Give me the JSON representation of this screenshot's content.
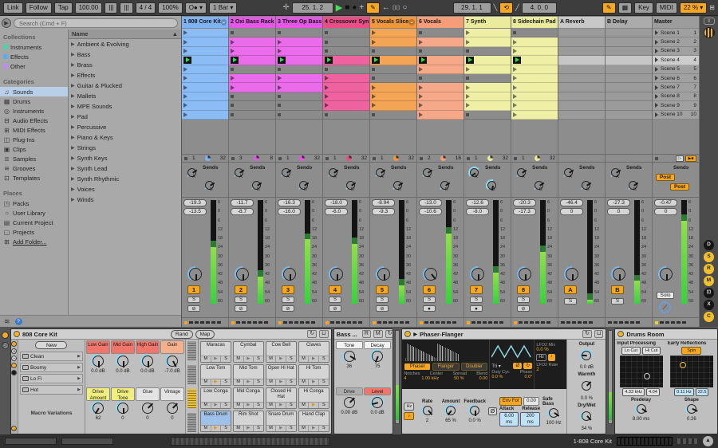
{
  "toolbar": {
    "link": "Link",
    "follow": "Follow",
    "tap": "Tap",
    "tempo": "100.00",
    "pips1": "|||",
    "pips2": "|||",
    "sig": "4 / 4",
    "quant": "100%",
    "groove": "O●",
    "bar": "1 Bar",
    "pos": "25. 1. 2",
    "loop_start": "29. 1. 1",
    "loop_len": "4. 0. 0",
    "key": "Key",
    "midi": "MIDI",
    "cpu": "22 %"
  },
  "browser": {
    "search_placeholder": "Search (Cmd + F)",
    "collections_label": "Collections",
    "collections": [
      {
        "label": "Instruments",
        "color": "#4ad6a5"
      },
      {
        "label": "Effects",
        "color": "#5aaef0"
      },
      {
        "label": "Other",
        "color": "#b98ef0"
      }
    ],
    "categories_label": "Categories",
    "categories": [
      {
        "icon": "♫",
        "label": "Sounds"
      },
      {
        "icon": "▦",
        "label": "Drums"
      },
      {
        "icon": "◎",
        "label": "Instruments"
      },
      {
        "icon": "⊟",
        "label": "Audio Effects"
      },
      {
        "icon": "⊞",
        "label": "MIDI Effects"
      },
      {
        "icon": "◫",
        "label": "Plug-Ins"
      },
      {
        "icon": "▣",
        "label": "Clips"
      },
      {
        "icon": "≣",
        "label": "Samples"
      },
      {
        "icon": "≋",
        "label": "Grooves"
      },
      {
        "icon": "⊡",
        "label": "Templates"
      }
    ],
    "selected_category": "Sounds",
    "places_label": "Places",
    "places": [
      {
        "icon": "◳",
        "label": "Packs"
      },
      {
        "icon": "○",
        "label": "User Library"
      },
      {
        "icon": "▤",
        "label": "Current Project"
      },
      {
        "icon": "▢",
        "label": "Projects"
      },
      {
        "icon": "⊞",
        "label": "Add Folder..."
      }
    ],
    "list_header": "Name",
    "list_items": [
      "Ambient & Evolving",
      "Bass",
      "Brass",
      "Effects",
      "Guitar & Plucked",
      "Mallets",
      "MPE Sounds",
      "Pad",
      "Percussive",
      "Piano & Keys",
      "Strings",
      "Synth Keys",
      "Synth Lead",
      "Synth Rhythmic",
      "Voices",
      "Winds"
    ]
  },
  "session": {
    "sends_label": "Sends",
    "scale": [
      "6",
      "0",
      "6",
      "12",
      "18",
      "24",
      "30",
      "36",
      "42",
      "48",
      "54",
      "60"
    ],
    "scenes": [
      "Scene 1",
      "Scene 2",
      "Scene 3",
      "Scene 4",
      "Scene 5",
      "Scene 6",
      "Scene 7",
      "Scene 8",
      "Scene 9",
      "Scene 10"
    ],
    "active_scene": 3,
    "tracks": [
      {
        "name": "1 808 Core Kit",
        "dd": true,
        "color": "#7fb2f3",
        "clip": "#8cbcf5",
        "slots": "cccpcccccc",
        "count": "1",
        "len": "32",
        "peak": "-19.3",
        "vol": "-13.5",
        "meter": 55,
        "pan": 50,
        "arm": "⊘"
      },
      {
        "name": "2 Oxi Bass Rack",
        "dd": false,
        "color": "#e457e4",
        "clip": "#ea6cea",
        "slots": "sccpsccsss",
        "count": "3",
        "len": "8",
        "peak": "-11.7",
        "vol": "-8.7",
        "meter": 26,
        "pan": 50,
        "arm": "⊘"
      },
      {
        "name": "3 Three Op Bass",
        "dd": false,
        "color": "#e457e4",
        "clip": "#ea6cea",
        "slots": "sccpsccsss",
        "count": "1",
        "len": "32",
        "peak": "-16.3",
        "vol": "-16.0",
        "meter": 62,
        "pan": 50,
        "arm": "⊘"
      },
      {
        "name": "4 Crossover Syn",
        "dd": false,
        "color": "#ea4e87",
        "clip": "#ee62a0",
        "slots": "ssspsccccs",
        "count": "1",
        "len": "32",
        "peak": "-18.0",
        "vol": "-6.0",
        "meter": 58,
        "pan": 50,
        "arm": "⊘"
      },
      {
        "name": "5 Vocals Slice",
        "dd": true,
        "color": "#f0983c",
        "clip": "#f3a455",
        "slots": "ccspsscccs",
        "count": "1",
        "len": "32",
        "peak": "-8.94",
        "vol": "-9.3",
        "meter": 18,
        "pan": 50,
        "arm": "⊘"
      },
      {
        "name": "6 Vocals",
        "dd": false,
        "color": "#f49d78",
        "clip": "#f6a988",
        "slots": "scspcscccc",
        "count": "2",
        "len": "16",
        "peak": "-13.0",
        "vol": "-10.6",
        "meter": 68,
        "pan": 36,
        "arm": "●"
      },
      {
        "name": "7 Synth",
        "dd": false,
        "color": "#ebeb9d",
        "clip": "#eff0a6",
        "slots": "ccspcscccs",
        "count": "1",
        "len": "32",
        "peak": "-12.6",
        "vol": "-8.0",
        "meter": 30,
        "pan": 50,
        "arm": "●"
      },
      {
        "name": "8 Sidechain Pad",
        "dd": false,
        "color": "#ebeb9d",
        "clip": "#eff0a6",
        "slots": "sccpcccccc",
        "count": "1",
        "len": "32",
        "peak": "-20.3",
        "vol": "-17.3",
        "meter": 50,
        "pan": 50,
        "arm": "⊘"
      }
    ],
    "returns": [
      {
        "name": "A Reverb",
        "num": "A",
        "color": "#c8c8c8",
        "peak": "-46.4",
        "vol": "0",
        "meter": 4
      },
      {
        "name": "B Delay",
        "num": "B",
        "color": "#ababab",
        "peak": "-27.3",
        "vol": "0",
        "meter": 22
      }
    ],
    "master": {
      "name": "Master",
      "color": "#9c9c9c",
      "peak": "-0.47",
      "vol": "0",
      "meter": 80,
      "post1": "Post",
      "post2": "Post",
      "solo": "Solo",
      "s_label": "S"
    },
    "s_label": "S",
    "right_buttons": [
      {
        "l": "D",
        "y": false
      },
      {
        "l": "S",
        "y": true
      },
      {
        "l": "R",
        "y": true
      },
      {
        "l": "M",
        "y": true
      },
      {
        "l": "⊡",
        "y": false
      },
      {
        "l": "X",
        "y": false
      },
      {
        "l": "C",
        "y": true
      }
    ]
  },
  "devices": {
    "kit": {
      "title": "808 Core Kit",
      "rand": "Rand",
      "map": "Map",
      "new_label": "New",
      "variations": [
        "Clean",
        "Boomy",
        "Lo Fi",
        "Hot"
      ],
      "macro_label": "Macro Variations",
      "macros": [
        {
          "label": "Low Gain",
          "value": "0.0 dB",
          "color": "#f0756b",
          "pct": 50
        },
        {
          "label": "Mid Gain",
          "value": "0.0 dB",
          "color": "#f0756b",
          "pct": 50
        },
        {
          "label": "High Gain",
          "value": "0.0 dB",
          "color": "#f0756b",
          "pct": 50
        },
        {
          "label": "Gain",
          "value": "-7.0 dB",
          "color": "#f5b08c",
          "pct": 40
        },
        {
          "label": "Drive Amount",
          "value": "62",
          "color": "#f0ee7e",
          "pct": 62
        },
        {
          "label": "Drive Tone",
          "value": "0",
          "color": "#f0ee7e",
          "pct": 50
        },
        {
          "label": "Glue",
          "value": "0",
          "color": "#e4e4e4",
          "pct": 0
        },
        {
          "label": "Vintage",
          "value": "0",
          "color": "#e4e4e4",
          "pct": 0
        }
      ],
      "m": "M",
      "s": "S",
      "pads": [
        [
          "Maracas",
          "Cymbal",
          "Cow Bell",
          "Claves"
        ],
        [
          "Low Tom",
          "Mid Tom",
          "Open Hi Hat",
          "Hi Tom"
        ],
        [
          "Low Conga",
          "Mid Conga",
          "Closed Hi Hat",
          "Hi Conga"
        ],
        [
          "Bass Drum",
          "Rim Shot",
          "Snare Drum",
          "Hand Clap"
        ]
      ],
      "pad_selected": "Bass Drum",
      "pad_playing": [
        "Low Tom",
        "Hi Conga",
        "Bass Drum"
      ]
    },
    "bass": {
      "title": "Bass ...",
      "knobs": [
        {
          "label": "Tone",
          "value": "36",
          "bg": "#f2f2f2",
          "pct": 28
        },
        {
          "label": "Decay",
          "value": "75",
          "bg": "#f2f2f2",
          "pct": 59
        },
        {
          "label": "Drive",
          "value": "0.00 dB",
          "bg": "#aeaeae",
          "pct": 0
        },
        {
          "label": "Level",
          "value": "0.0 dB",
          "bg": "#f0756b",
          "pct": 78
        }
      ]
    },
    "phaser": {
      "title": "Phaser-Flanger",
      "modes": [
        "Phaser",
        "Flanger",
        "Doubler"
      ],
      "active_mode": "Phaser",
      "param_labels": [
        "Notches",
        "Center",
        "Spread",
        "Blend"
      ],
      "param_values": [
        "4",
        "1.00 kHz",
        "50 %",
        "0.00"
      ],
      "wave_type": "Tri",
      "inv": "Ø",
      "retrig": "↻",
      "duty_label": "Duty Cyc",
      "duty": "0.0 %",
      "phase_label": "Phase",
      "phase": "0.0°",
      "lfo2_mix_label": "LFO2 Mix",
      "lfo2_mix": "0.0 %",
      "hz": "Hz",
      "note": "♪",
      "lfo2_rate_label": "LFO2 Rate",
      "lfo2_rate": "2",
      "rate": {
        "label": "Rate",
        "value": "2",
        "pct": 35
      },
      "amount": {
        "label": "Amount",
        "value": "65 %",
        "pct": 65
      },
      "feedback": {
        "label": "Feedback",
        "value": "0.0 %",
        "pct": 50
      },
      "env_label": "Env Fol",
      "env_amt": "0.00",
      "attack_label": "Attack",
      "attack": "6.00 ms",
      "release_label": "Release",
      "release": "200 ms",
      "safe_bass": {
        "label": "Safe Bass",
        "value": "100 Hz",
        "pct": 30
      },
      "output": {
        "label": "Output",
        "value": "0.0 dB",
        "pct": 85
      },
      "warmth": {
        "label": "Warmth",
        "value": "0.0 %",
        "pct": 0
      },
      "drywet": {
        "label": "Dry/Wet",
        "value": "34 %",
        "pct": 34
      }
    },
    "reverb": {
      "title": "Drums Room",
      "input_label": "Input Processing",
      "lo_cut": "Lo Cut",
      "hi_cut": "Hi Cut",
      "in_x": "4.33 kHz",
      "in_y": "4.04",
      "er_label": "Early Reflections",
      "spin": "Spin",
      "er_x": "0.11 Hz",
      "er_y": "22.5",
      "predelay": {
        "label": "Predelay",
        "value": "8.00 ms",
        "pct": 30
      },
      "shape": {
        "label": "Shape",
        "value": "0.26",
        "pct": 26
      }
    }
  },
  "status_bar": {
    "current": "1-808 Core Kit"
  }
}
